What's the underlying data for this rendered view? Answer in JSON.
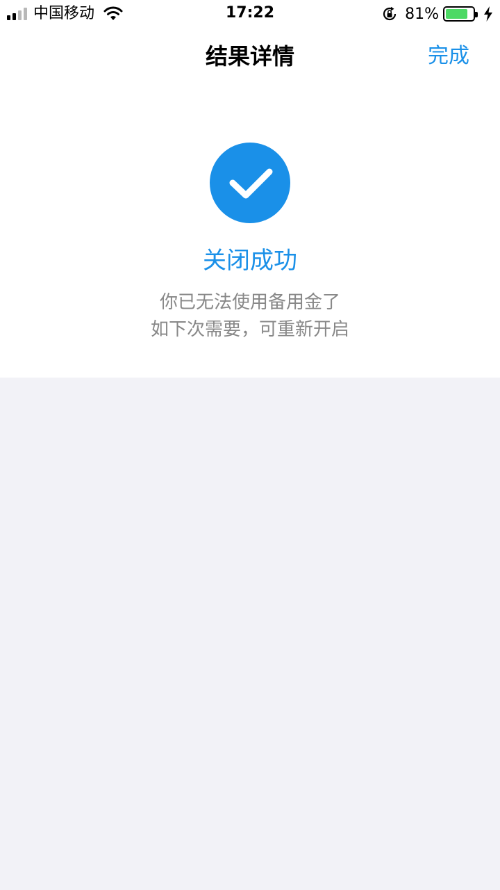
{
  "status_bar": {
    "carrier": "中国移动",
    "time": "17:22",
    "battery_percent": "81%",
    "battery_level": 0.81,
    "icons": [
      "signal-icon",
      "wifi-icon",
      "rotation-lock-icon",
      "battery-icon",
      "charging-icon"
    ]
  },
  "nav": {
    "title": "结果详情",
    "done_label": "完成"
  },
  "result": {
    "icon": "check-circle-icon",
    "title": "关闭成功",
    "description_line1": "你已无法使用备用金了",
    "description_line2": "如下次需要，可重新开启"
  },
  "colors": {
    "accent": "#1a90e8",
    "text_secondary": "#888888",
    "background": "#f2f2f7",
    "battery_fill": "#4cd964"
  }
}
